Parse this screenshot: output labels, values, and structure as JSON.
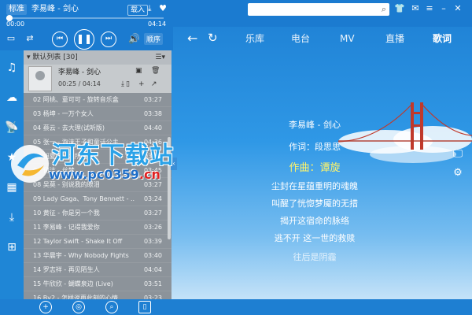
{
  "player": {
    "quality": "标准",
    "now_playing": "李易峰 - 剑心",
    "download_badge": "载入",
    "time_current": "00:00",
    "time_total": "04:14",
    "progress": 0.02,
    "play_order": "顺序"
  },
  "search": {
    "placeholder": ""
  },
  "nav": {
    "tabs": [
      {
        "label": "乐库"
      },
      {
        "label": "电台"
      },
      {
        "label": "MV"
      },
      {
        "label": "直播"
      },
      {
        "label": "歌词"
      }
    ],
    "active": "歌词"
  },
  "playlist": {
    "title": "默认列表 [30]",
    "current": {
      "name": "李易峰 - 剑心",
      "time": "00:25 / 04:14"
    },
    "tracks": [
      {
        "name": "02  阿桃、童可可 - 旋转音乐盒",
        "dur": "03:27"
      },
      {
        "name": "03  杨坤 - 一万个女人",
        "dur": "03:38"
      },
      {
        "name": "04  蔡云 - 去大理(试听版)",
        "dur": "04:40"
      },
      {
        "name": "05  张一 - 泡沫王子和童话公主",
        "dur": "04:36"
      },
      {
        "name": "06  胡夏 - 心之所属",
        "dur": "03:40"
      },
      {
        "name": "07  何洁 - 丝梦",
        "dur": "03:45"
      },
      {
        "name": "08  吴莫 - 别说我的眼泪",
        "dur": "03:27"
      },
      {
        "name": "09  Lady Gaga、Tony Bennett - ...",
        "dur": "03:24"
      },
      {
        "name": "10  黄征 - 你是另一个我",
        "dur": "03:27"
      },
      {
        "name": "11  李易峰 - 记得我爱你",
        "dur": "03:26"
      },
      {
        "name": "12  Taylor Swift - Shake It Off",
        "dur": "03:39"
      },
      {
        "name": "13  华晨宇 - Why Nobody Fights",
        "dur": "03:40"
      },
      {
        "name": "14  罗志祥 - 再见陌生人",
        "dur": "04:04"
      },
      {
        "name": "15  牛欣欣 - 蝴蝶泉边 (Live)",
        "dur": "03:51"
      },
      {
        "name": "16  By2 - 怎样说再此刻的心情",
        "dur": "03:23"
      },
      {
        "name": "17  李家辉 - 晚安(Live)",
        "dur": "03:39"
      }
    ]
  },
  "lyrics": {
    "lines": [
      {
        "text": "李易峰 - 剑心",
        "style": "normal"
      },
      {
        "text": "作词：段思思",
        "style": "normal"
      },
      {
        "text": "作曲：谭旋",
        "style": "cur"
      },
      {
        "text": "尘封在星蕴重明的魂魄",
        "style": "normal"
      },
      {
        "text": "叫醒了恍惚梦魇的无措",
        "style": "normal"
      },
      {
        "text": "揭开这宿命的脉络",
        "style": "normal"
      },
      {
        "text": "逃不开 这一世的救赎",
        "style": "normal"
      },
      {
        "text": "往后是阴霾",
        "style": "dim"
      }
    ]
  },
  "watermark": {
    "name": "河东下载站",
    "url_main": "www.pc0359",
    "url_tld": ".cn"
  },
  "colors": {
    "accent": "#1b7bd0",
    "current_lyric": "#fff46a",
    "bridge": "#c0392b"
  }
}
